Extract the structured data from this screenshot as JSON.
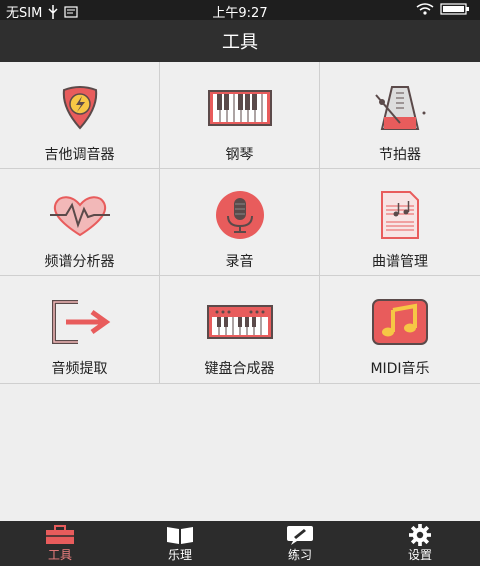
{
  "status": {
    "carrier": "无SIM",
    "time": "上午9:27"
  },
  "header": {
    "title": "工具"
  },
  "tools": [
    {
      "label": "吉他调音器",
      "icon": "guitar-pick-icon"
    },
    {
      "label": "钢琴",
      "icon": "piano-keys-icon"
    },
    {
      "label": "节拍器",
      "icon": "metronome-icon"
    },
    {
      "label": "频谱分析器",
      "icon": "heart-wave-icon"
    },
    {
      "label": "录音",
      "icon": "microphone-icon"
    },
    {
      "label": "曲谱管理",
      "icon": "sheet-music-icon"
    },
    {
      "label": "音频提取",
      "icon": "extract-arrow-icon"
    },
    {
      "label": "键盘合成器",
      "icon": "synth-keyboard-icon"
    },
    {
      "label": "MIDI音乐",
      "icon": "midi-note-icon"
    }
  ],
  "tabs": [
    {
      "label": "工具",
      "icon": "toolbox-icon",
      "active": true
    },
    {
      "label": "乐理",
      "icon": "book-icon"
    },
    {
      "label": "练习",
      "icon": "practice-icon"
    },
    {
      "label": "设置",
      "icon": "gear-icon"
    }
  ],
  "colors": {
    "accent": "#f08080",
    "icon_red": "#e85c5c",
    "icon_dark": "#5b4a4a"
  }
}
